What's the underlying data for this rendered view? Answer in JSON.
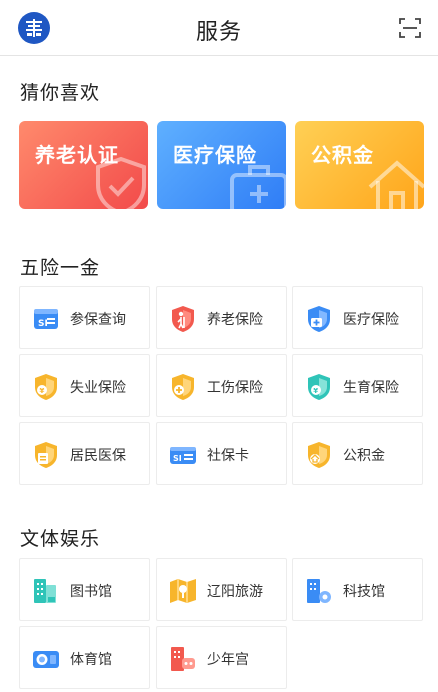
{
  "header": {
    "title": "服务",
    "logo_icon": "emblem-logo-icon",
    "scan_icon": "scan-icon"
  },
  "recommend": {
    "title": "猜你喜欢",
    "cards": [
      {
        "label": "养老认证",
        "icon": "shield-check-icon",
        "color_from": "#ff7a6a",
        "color_to": "#f44b4b"
      },
      {
        "label": "医疗保险",
        "icon": "medkit-icon",
        "color_from": "#56a8ff",
        "color_to": "#2f7df6"
      },
      {
        "label": "公积金",
        "icon": "house-icon",
        "color_from": "#ffc94a",
        "color_to": "#ffa718"
      }
    ]
  },
  "insurance": {
    "title": "五险一金",
    "items": [
      {
        "label": "参保查询",
        "icon": "si-card-icon",
        "color": "#3a8cf5"
      },
      {
        "label": "养老保险",
        "icon": "elder-shield-icon",
        "color": "#f2594e"
      },
      {
        "label": "医疗保险",
        "icon": "medical-shield-icon",
        "color": "#3a8cf5"
      },
      {
        "label": "失业保险",
        "icon": "unemployment-shield-icon",
        "color": "#f7b52c"
      },
      {
        "label": "工伤保险",
        "icon": "injury-shield-icon",
        "color": "#f7b52c"
      },
      {
        "label": "生育保险",
        "icon": "maternity-shield-icon",
        "color": "#2fc4b8"
      },
      {
        "label": "居民医保",
        "icon": "resident-medical-icon",
        "color": "#f7b52c"
      },
      {
        "label": "社保卡",
        "icon": "social-card-icon",
        "color": "#3a8cf5"
      },
      {
        "label": "公积金",
        "icon": "fund-house-icon",
        "color": "#f7b52c"
      }
    ]
  },
  "culture": {
    "title": "文体娱乐",
    "items": [
      {
        "label": "图书馆",
        "icon": "library-icon",
        "color": "#2fc4b8"
      },
      {
        "label": "辽阳旅游",
        "icon": "travel-map-icon",
        "color": "#f7b52c"
      },
      {
        "label": "科技馆",
        "icon": "science-museum-icon",
        "color": "#3a8cf5"
      },
      {
        "label": "体育馆",
        "icon": "stadium-icon",
        "color": "#3a8cf5"
      },
      {
        "label": "少年宫",
        "icon": "youth-palace-icon",
        "color": "#f2594e"
      }
    ]
  }
}
